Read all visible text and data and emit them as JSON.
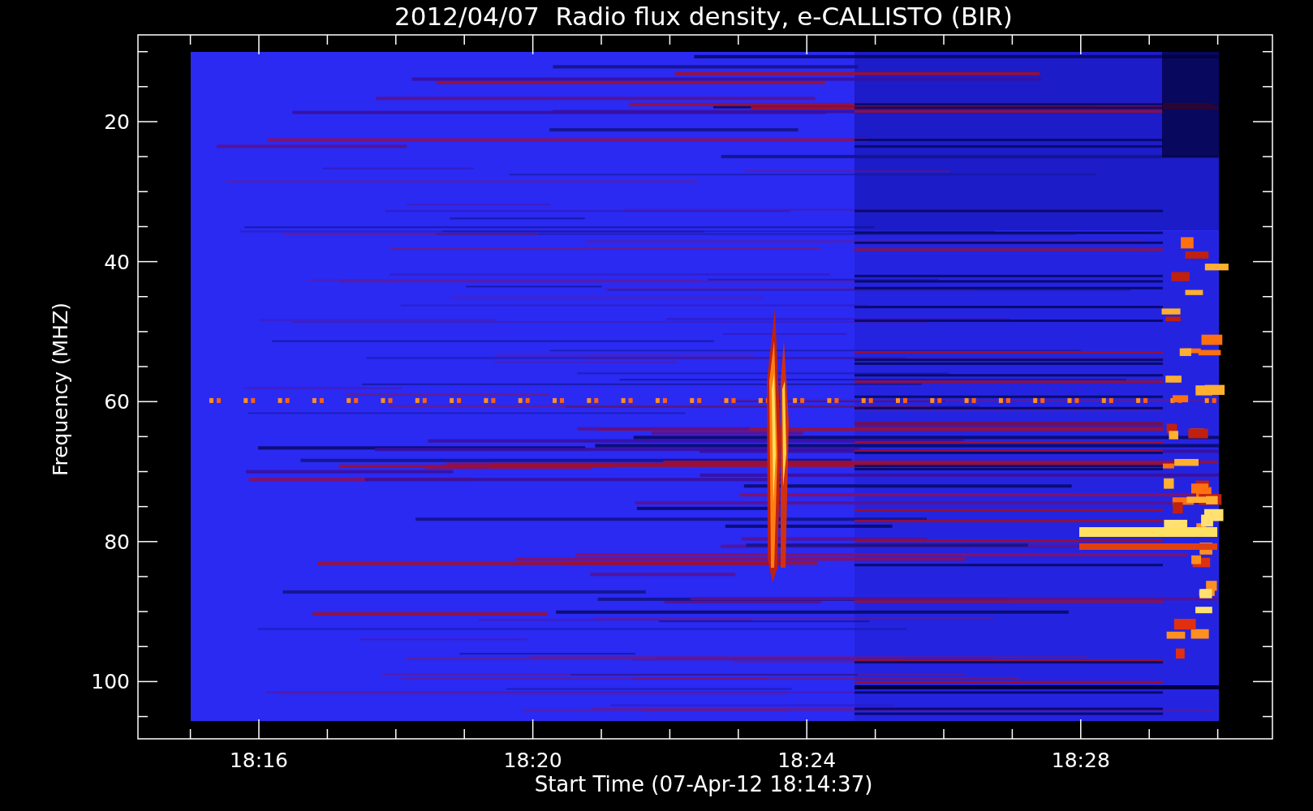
{
  "plot": {
    "title": "2012/04/07  Radio flux density, e-CALLISTO (BIR)",
    "xlabel": "Start Time (07-Apr-12 18:14:37)",
    "ylabel": "Frequency (MHZ)",
    "x_tick_labels": [
      "18:16",
      "18:20",
      "18:24",
      "18:28"
    ],
    "y_tick_labels": [
      "20",
      "40",
      "60",
      "80",
      "100"
    ]
  }
}
